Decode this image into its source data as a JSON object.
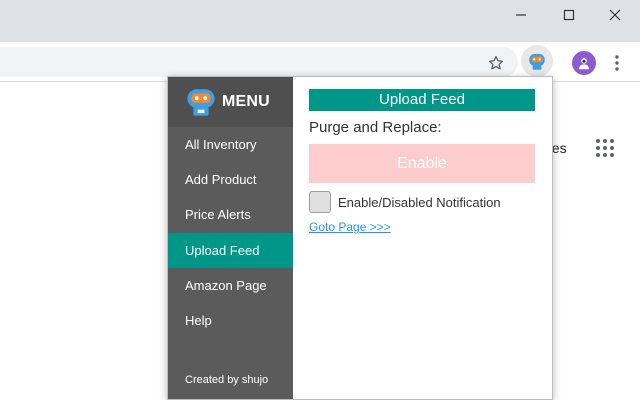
{
  "browser": {
    "window_controls": {
      "minimize": "—",
      "maximize": "☐",
      "close": "✕"
    }
  },
  "page": {
    "partial_text": "ges"
  },
  "popup": {
    "sidebar": {
      "menu_title": "MENU",
      "items": [
        {
          "label": "All Inventory",
          "active": false
        },
        {
          "label": "Add Product",
          "active": false
        },
        {
          "label": "Price Alerts",
          "active": false
        },
        {
          "label": "Upload Feed",
          "active": true
        },
        {
          "label": "Amazon Page",
          "active": false
        },
        {
          "label": "Help",
          "active": false
        }
      ],
      "credit": "Created by shujo"
    },
    "content": {
      "title": "Upload Feed",
      "purge_label": "Purge and Replace:",
      "enable_button": "Enable",
      "notification_label": "Enable/Disabled Notification",
      "goto_link": "Goto Page >>>"
    }
  },
  "colors": {
    "accent": "#009688",
    "sidebar_bg": "#5b5b5b",
    "enable_button_bg": "#fdcccc",
    "link": "#2196f3"
  },
  "icons": {
    "toolbar": [
      "star-icon",
      "extension-robot-icon",
      "profile-avatar-icon",
      "kebab-menu-icon"
    ],
    "popup_logo": "robot-logo-icon",
    "apps": "apps-grid-icon"
  }
}
